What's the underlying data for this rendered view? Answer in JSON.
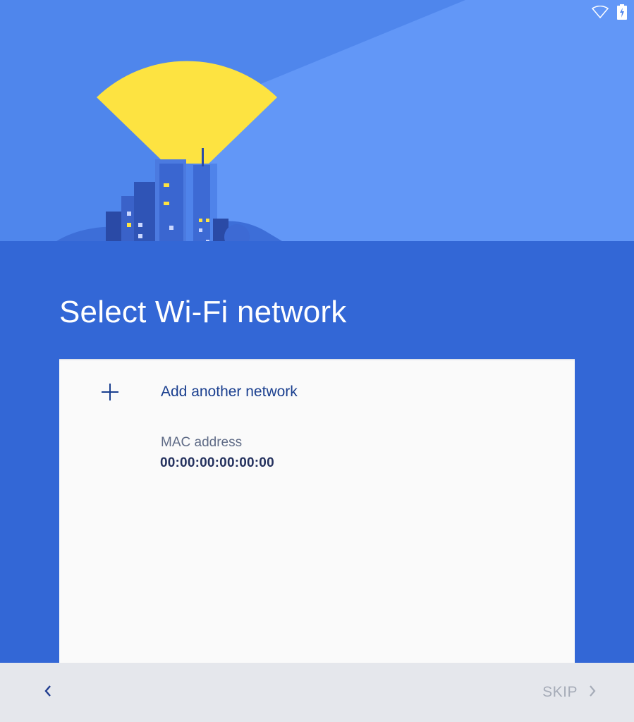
{
  "status_bar": {
    "wifi_icon": "wifi-outline-icon",
    "battery_icon": "battery-charging-icon"
  },
  "illustration": {
    "sky_color": "#4f86ec",
    "beam_color": "#6297f7",
    "signal_color": "#fde341",
    "ground_color": "#3367d6"
  },
  "page": {
    "title": "Select Wi-Fi network"
  },
  "network_list": {
    "add_network_icon": "plus-icon",
    "add_network_label": "Add another network",
    "mac_label": "MAC address",
    "mac_value": "00:00:00:00:00:00"
  },
  "footer": {
    "back_icon": "chevron-left-icon",
    "skip_label": "SKIP",
    "skip_icon": "chevron-right-icon"
  }
}
